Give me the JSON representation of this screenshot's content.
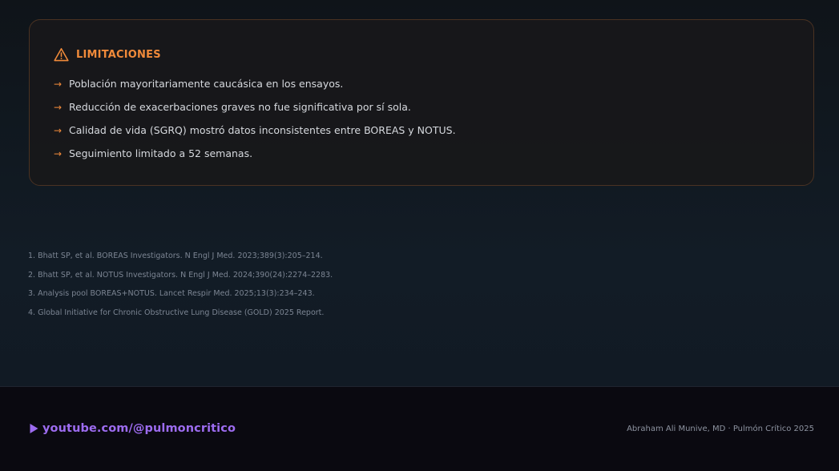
{
  "limitations": {
    "title": "LIMITACIONES",
    "icon": "warning-triangle-icon",
    "bullet_icon": "arrow-right-icon",
    "accent_color": "#f08a3a",
    "items": [
      "Población mayoritariamente caucásica en los ensayos.",
      "Reducción de exacerbaciones graves no fue significativa por sí sola.",
      "Calidad de vida (SGRQ) mostró datos inconsistentes entre BOREAS y NOTUS.",
      "Seguimiento limitado a 52 semanas."
    ]
  },
  "references": [
    "1. Bhatt SP, et al. BOREAS Investigators. N Engl J Med. 2023;389(3):205–214.",
    "2. Bhatt SP, et al. NOTUS Investigators. N Engl J Med. 2024;390(24):2274–2283.",
    "3. Analysis pool BOREAS+NOTUS. Lancet Respir Med. 2025;13(3):234–243.",
    "4. Global Initiative for Chronic Obstructive Lung Disease (GOLD) 2025 Report."
  ],
  "footer": {
    "channel_link": "youtube.com/@pulmoncritico",
    "channel_icon": "play-icon",
    "channel_color": "#9d6cf0",
    "credit": "Abraham Ali Munive, MD · Pulmón Crítico 2025"
  }
}
